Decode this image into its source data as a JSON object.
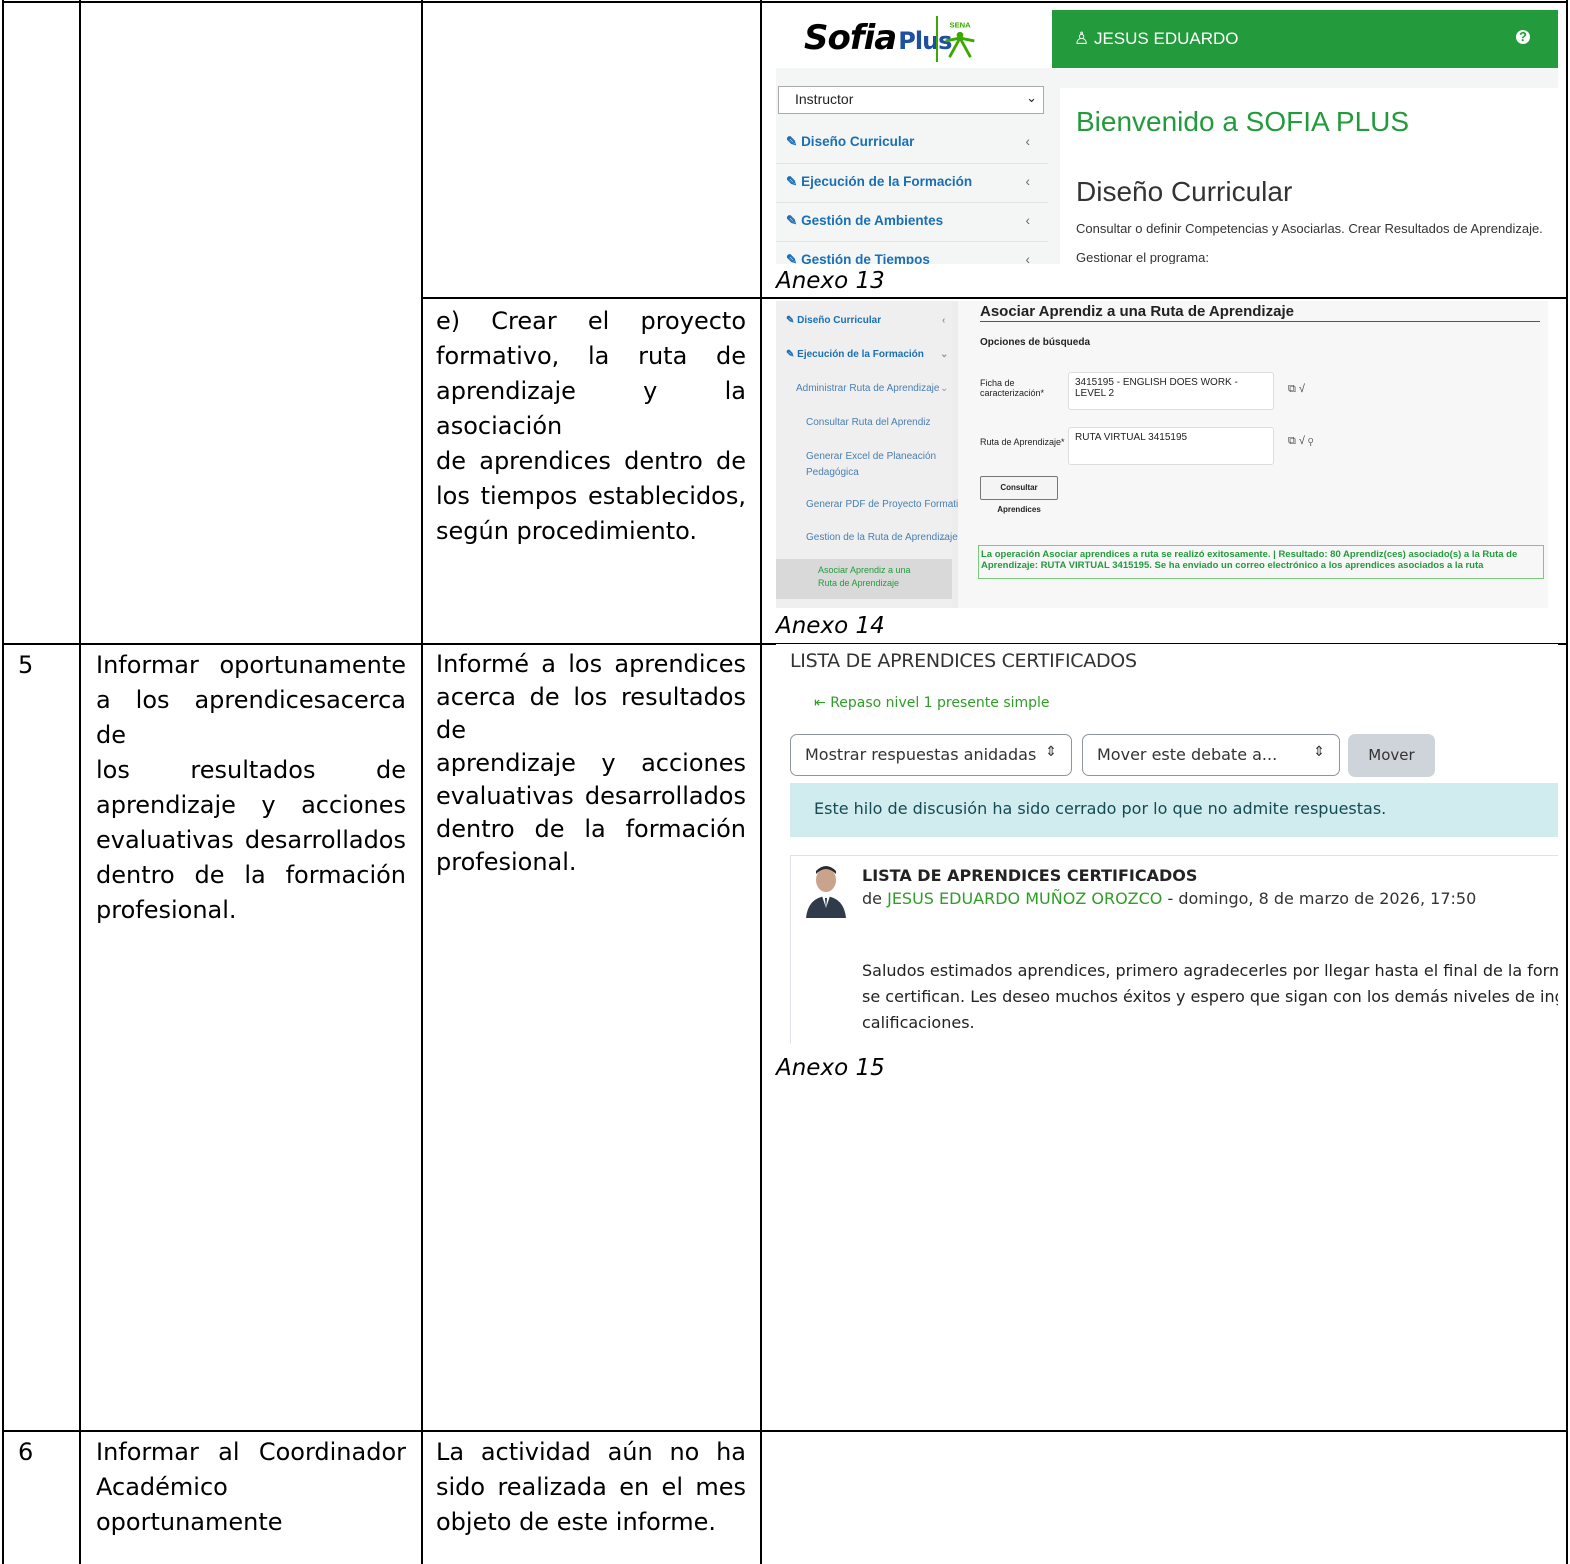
{
  "rows": {
    "row5": {
      "number": "5",
      "col2_lines": [
        "Informar oportunamente",
        "a los aprendicesacerca de",
        "los resultados de",
        "aprendizaje y acciones",
        "evaluativas desarrollados",
        "dentro de la formación",
        "profesional."
      ],
      "col3_lines": [
        "Informé a los aprendices",
        "acerca de los resultados de",
        "aprendizaje y acciones",
        "evaluativas desarrollados",
        "dentro de la formación",
        "profesional."
      ]
    },
    "row6": {
      "number": "6",
      "col2_lines": [
        "Informar al Coordinador",
        "Académico",
        "oportunamente"
      ],
      "col3_lines": [
        "La actividad aún no ha",
        "sido realizada en el mes",
        "objeto de este informe."
      ]
    },
    "item_e_lines": [
      "e) Crear el proyecto",
      "formativo, la ruta de",
      "aprendizaje y la asociación",
      "de aprendices dentro de",
      "los tiempos establecidos,",
      "según procedimiento."
    ]
  },
  "captions": {
    "anexo13": "Anexo 13",
    "anexo14": "Anexo 14",
    "anexo15": "Anexo 15"
  },
  "anexo13": {
    "logo_main": "Sofia",
    "logo_plus": "Plus",
    "user": "JESUS EDUARDO",
    "role_select": "Instructor",
    "menu": [
      "Diseño Curricular",
      "Ejecución de la Formación",
      "Gestión de Ambientes",
      "Gestión de Tiempos"
    ],
    "welcome": "Bienvenido a SOFIA PLUS",
    "section": "Diseño Curricular",
    "desc": "Consultar o definir Competencias y Asociarlas. Crear Resultados de Aprendizaje.",
    "desc2": "Gestionar el programa:",
    "colors": {
      "green": "#239b3c",
      "link": "#1a6fb4"
    }
  },
  "anexo14": {
    "menu": {
      "diseno": "Diseño Curricular",
      "ejecucion": "Ejecución de la Formación",
      "administrar": "Administrar Ruta de Aprendizaje",
      "consultar": "Consultar Ruta del Aprendiz",
      "excel_1": "Generar Excel de Planeación",
      "excel_2": "Pedagógica",
      "pdf": "Generar PDF de Proyecto Formativo",
      "gestion": "Gestion de la Ruta de Aprendizaje",
      "active": "Asociar Aprendiz a una Ruta de Aprendizaje"
    },
    "title": "Asociar Aprendiz a una Ruta de Aprendizaje",
    "subtitle": "Opciones de búsqueda",
    "ficha_label_1": "Ficha de",
    "ficha_label_2": "caracterización*",
    "ficha_value": "3415195 - ENGLISH DOES WORK - LEVEL 2",
    "ruta_label": "Ruta de Aprendizaje*",
    "ruta_value": "RUTA VIRTUAL 3415195",
    "button": "Consultar Aprendices",
    "message": "La operación Asociar aprendices a ruta se realizó exitosamente. | Resultado: 80 Aprendiz(ces) asociado(s) a la Ruta de Aprendizaje: RUTA VIRTUAL 3415195. Se ha enviado un correo electrónico a los aprendices asociados a la ruta"
  },
  "anexo15": {
    "title": "LISTA DE APRENDICES CERTIFICADOS",
    "back_link": "Repaso nivel 1 presente simple",
    "select_display": "Mostrar respuestas anidadas",
    "select_move": "Mover este debate a...",
    "move_button": "Mover",
    "alert": "Este hilo de discusión ha sido cerrado por lo que no admite respuestas.",
    "post_title": "LISTA DE APRENDICES CERTIFICADOS",
    "post_by": "de",
    "post_author": "JESUS EDUARDO MUÑOZ OROZCO",
    "post_date": " - domingo, 8 de marzo de 2026, 17:50",
    "body_1": "Saludos estimados aprendices, primero agradecerles por llegar hasta el final de la formació",
    "body_2": "se certifican. Les deseo muchos éxitos y espero que sigan con los demás niveles de inglés. (",
    "body_3": "calificaciones.",
    "colors": {
      "link": "#2f9d27",
      "alert_bg": "#d1ecef"
    }
  }
}
